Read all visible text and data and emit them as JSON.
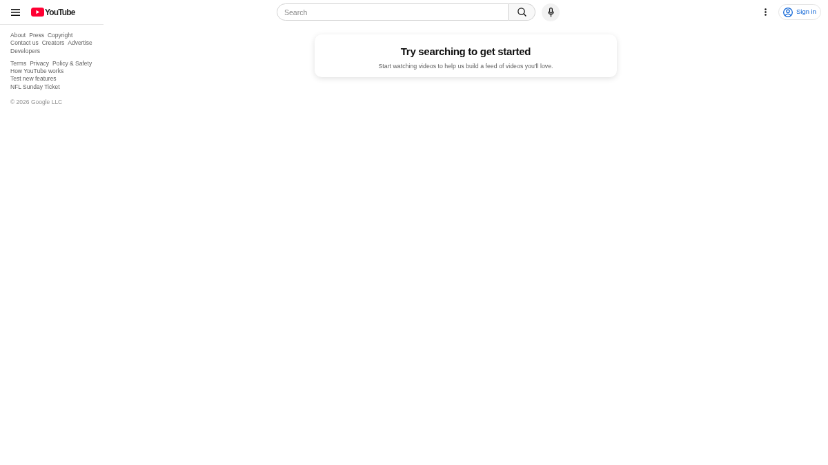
{
  "header": {
    "logo": {
      "text": "YouTube"
    },
    "search": {
      "placeholder": "Search"
    },
    "sign_in": {
      "label": "Sign in"
    }
  },
  "sidebar": {
    "footer_link_groups": [
      [
        "About",
        "Press",
        "Copyright",
        "Contact us",
        "Creators",
        "Advertise",
        "Developers"
      ],
      [
        "Terms",
        "Privacy",
        "Policy & Safety",
        "How YouTube works",
        "Test new features",
        "NFL Sunday Ticket"
      ]
    ],
    "copyright": "© 2026 Google LLC"
  },
  "empty_state": {
    "title": "Try searching to get started",
    "message": "Start watching videos to help us build a feed of videos you'll love."
  }
}
